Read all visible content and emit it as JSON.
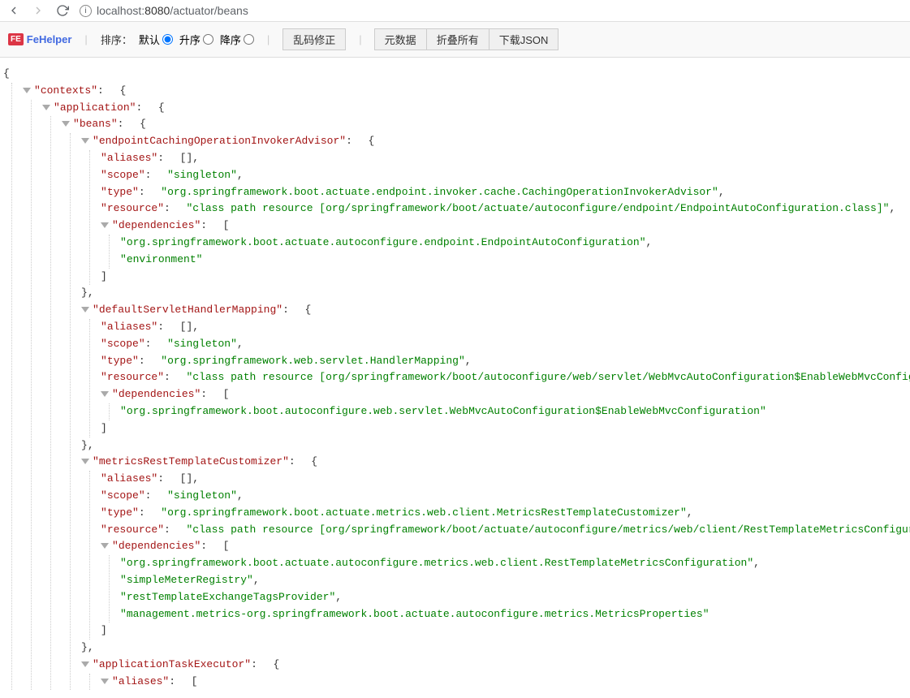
{
  "browser": {
    "url_host": "localhost:",
    "url_port": "8080",
    "url_path": "/actuator/beans"
  },
  "toolbar": {
    "logo_text": "FeHelper",
    "sort_label": "排序：",
    "radio_default": "默认",
    "radio_asc": "升序",
    "radio_desc": "降序",
    "btn_garbled": "乱码修正",
    "btn_meta": "元数据",
    "btn_collapse": "折叠所有",
    "btn_download": "下载JSON"
  },
  "json": {
    "k_contexts": "contexts",
    "k_application": "application",
    "k_beans": "beans",
    "k_aliases": "aliases",
    "k_scope": "scope",
    "k_type": "type",
    "k_resource": "resource",
    "k_dependencies": "dependencies",
    "v_singleton": "singleton",
    "bean1_name": "endpointCachingOperationInvokerAdvisor",
    "bean1_type": "org.springframework.boot.actuate.endpoint.invoker.cache.CachingOperationInvokerAdvisor",
    "bean1_resource": "class path resource [org/springframework/boot/actuate/autoconfigure/endpoint/EndpointAutoConfiguration.class]",
    "bean1_dep1": "org.springframework.boot.actuate.autoconfigure.endpoint.EndpointAutoConfiguration",
    "bean1_dep2": "environment",
    "bean2_name": "defaultServletHandlerMapping",
    "bean2_type": "org.springframework.web.servlet.HandlerMapping",
    "bean2_resource": "class path resource [org/springframework/boot/autoconfigure/web/servlet/WebMvcAutoConfiguration$EnableWebMvcConfiguration.cla",
    "bean2_dep1": "org.springframework.boot.autoconfigure.web.servlet.WebMvcAutoConfiguration$EnableWebMvcConfiguration",
    "bean3_name": "metricsRestTemplateCustomizer",
    "bean3_type": "org.springframework.boot.actuate.metrics.web.client.MetricsRestTemplateCustomizer",
    "bean3_resource": "class path resource [org/springframework/boot/actuate/autoconfigure/metrics/web/client/RestTemplateMetricsConfiguration.class",
    "bean3_dep1": "org.springframework.boot.actuate.autoconfigure.metrics.web.client.RestTemplateMetricsConfiguration",
    "bean3_dep2": "simpleMeterRegistry",
    "bean3_dep3": "restTemplateExchangeTagsProvider",
    "bean3_dep4": "management.metrics-org.springframework.boot.actuate.autoconfigure.metrics.MetricsProperties",
    "bean4_name": "applicationTaskExecutor"
  }
}
